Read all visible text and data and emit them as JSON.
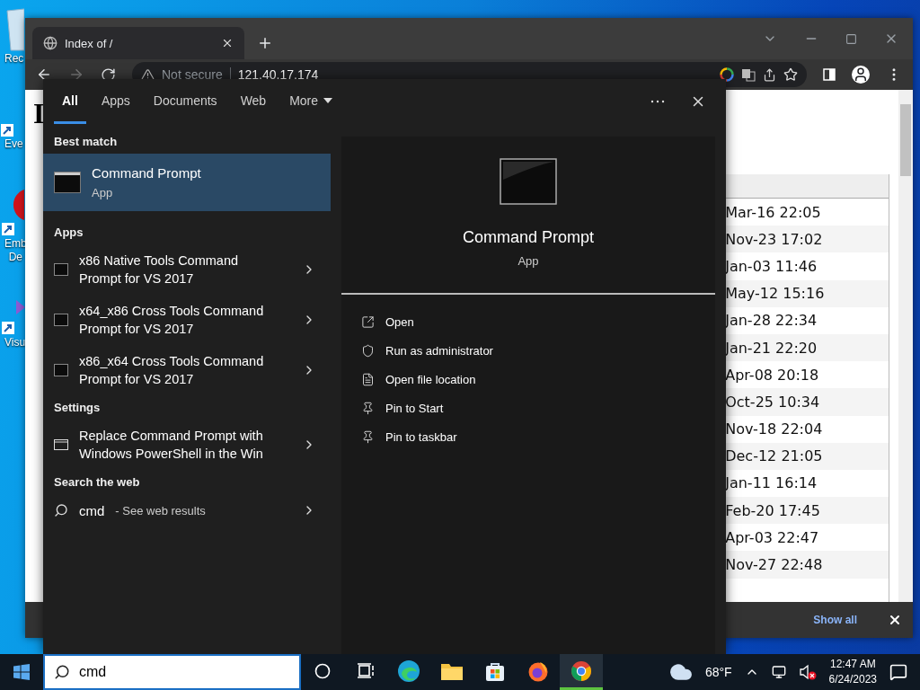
{
  "desktop": {
    "icons": [
      {
        "kind": "trash",
        "label": "Rec"
      },
      {
        "kind": "viewer",
        "label": "Eve"
      },
      {
        "kind": "red",
        "label": "Emb\nDe"
      },
      {
        "kind": "studio",
        "label": "Visu"
      }
    ]
  },
  "browser": {
    "tabs": [
      {
        "title": "Index of /",
        "selected": true
      }
    ],
    "security": "Not secure",
    "url": "121.40.17.174",
    "page": {
      "heading": "I",
      "dates": [
        "Mar-16 22:05",
        "Nov-23 17:02",
        "Jan-03 11:46",
        "May-12 15:16",
        "Jan-28 22:34",
        "Jan-21 22:20",
        "Apr-08 20:18",
        "Oct-25 10:34",
        "Nov-18 22:04",
        "Dec-12 21:05",
        "Jan-11 16:14",
        "Feb-20 17:45",
        "Apr-03 22:47",
        "Nov-27 22:48"
      ]
    },
    "download_bar": {
      "action": "Show all"
    }
  },
  "search_panel": {
    "tabs": [
      {
        "kind": "tab",
        "label": "All",
        "selected": true
      },
      {
        "kind": "tab",
        "label": "Apps",
        "selected": false
      },
      {
        "kind": "tab",
        "label": "Documents",
        "selected": false
      },
      {
        "kind": "tab",
        "label": "Web",
        "selected": false
      },
      {
        "kind": "dropdown",
        "label": "More",
        "selected": false
      }
    ],
    "best_match": {
      "heading": "Best match",
      "title": "Command Prompt",
      "subtitle": "App",
      "selected": true
    },
    "sections": [
      {
        "heading": "Apps",
        "items": [
          {
            "kind": "app",
            "label": "x86 Native Tools Command\nPrompt for VS 2017"
          },
          {
            "kind": "app",
            "label": "x64_x86 Cross Tools Command\nPrompt for VS 2017"
          },
          {
            "kind": "app",
            "label": "x86_x64 Cross Tools Command\nPrompt for VS 2017"
          }
        ]
      },
      {
        "heading": "Settings",
        "items": [
          {
            "kind": "setting",
            "label": "Replace Command Prompt with\nWindows PowerShell in the Win"
          }
        ]
      },
      {
        "heading": "Search the web",
        "items": [
          {
            "kind": "web",
            "label": "cmd",
            "suffix": "- See web results"
          }
        ]
      }
    ],
    "detail": {
      "title": "Command Prompt",
      "subtitle": "App",
      "actions": [
        {
          "kind": "open",
          "label": "Open"
        },
        {
          "kind": "admin",
          "label": "Run as administrator"
        },
        {
          "kind": "location",
          "label": "Open file location"
        },
        {
          "kind": "pin",
          "label": "Pin to Start"
        },
        {
          "kind": "pin",
          "label": "Pin to taskbar"
        }
      ]
    }
  },
  "taskbar": {
    "search": {
      "value": "cmd"
    },
    "apps": [
      {
        "kind": "cortana",
        "active": false
      },
      {
        "kind": "taskview",
        "active": false
      },
      {
        "kind": "edge",
        "active": false
      },
      {
        "kind": "explorer",
        "active": false
      },
      {
        "kind": "store",
        "active": false
      },
      {
        "kind": "firefox",
        "active": false
      },
      {
        "kind": "chrome",
        "active": true
      }
    ],
    "weather": "68°F",
    "volume_muted": true,
    "time": "12:47 AM",
    "date": "6/24/2023"
  }
}
